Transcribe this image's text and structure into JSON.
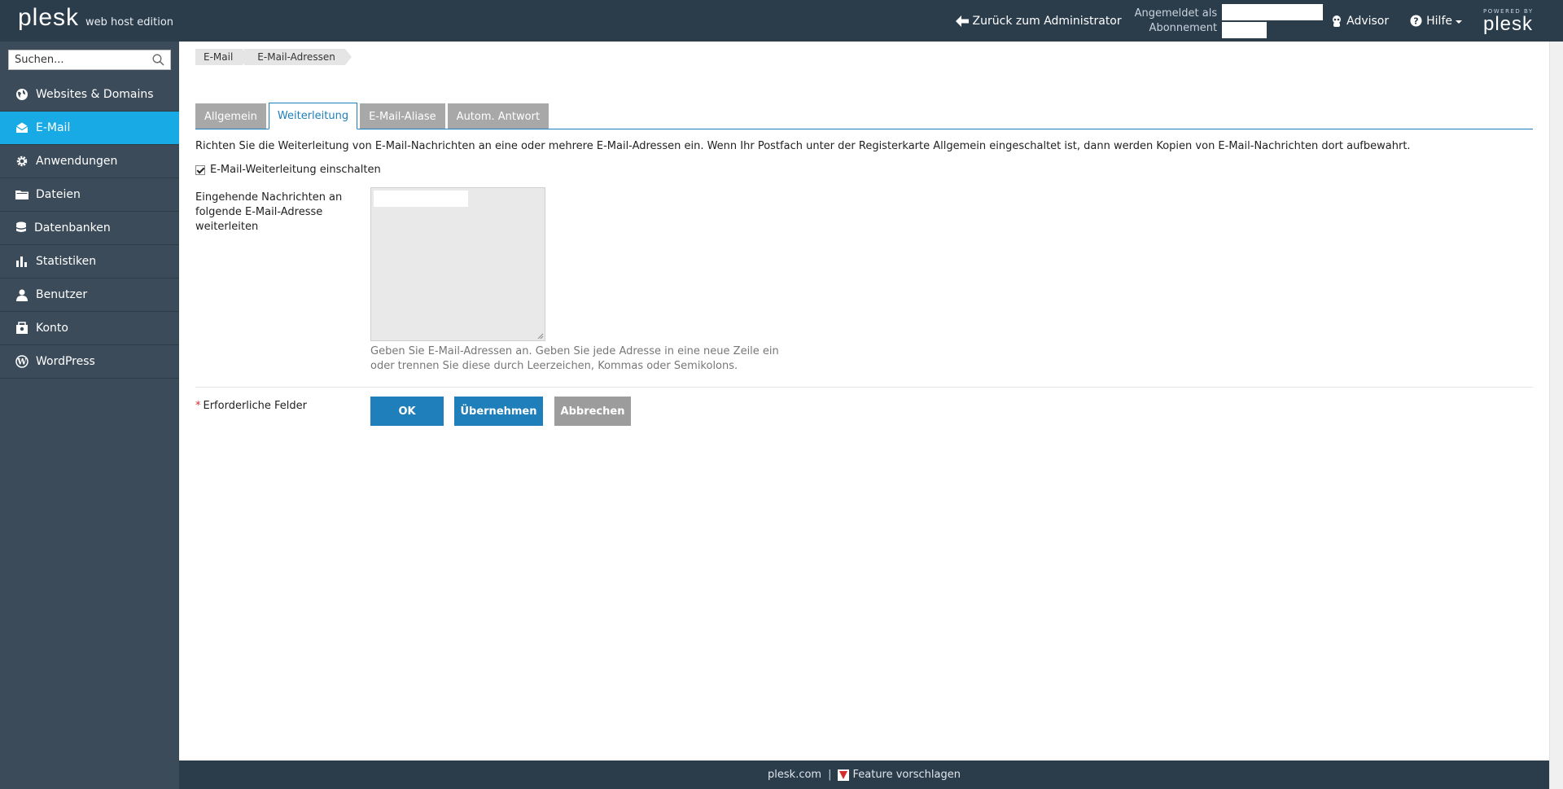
{
  "header": {
    "logo_text": "plesk",
    "edition": "web host edition",
    "back_label": "Zurück zum Administrator",
    "logged_in_label": "Angemeldet als",
    "subscription_label": "Abonnement",
    "advisor_label": "Advisor",
    "help_label": "Hilfe",
    "powered_by": "POWERED BY",
    "powered_logo": "plesk"
  },
  "sidebar": {
    "search_placeholder": "Suchen...",
    "items": [
      {
        "label": "Websites & Domains",
        "icon": "globe-icon"
      },
      {
        "label": "E-Mail",
        "icon": "mail-icon",
        "active": true
      },
      {
        "label": "Anwendungen",
        "icon": "gear-icon"
      },
      {
        "label": "Dateien",
        "icon": "folder-icon"
      },
      {
        "label": "Datenbanken",
        "icon": "database-icon"
      },
      {
        "label": "Statistiken",
        "icon": "bar-chart-icon"
      },
      {
        "label": "Benutzer",
        "icon": "user-icon"
      },
      {
        "label": "Konto",
        "icon": "account-icon"
      },
      {
        "label": "WordPress",
        "icon": "wordpress-icon"
      }
    ]
  },
  "breadcrumb": [
    "E-Mail",
    "E-Mail-Adressen"
  ],
  "tabs": [
    {
      "label": "Allgemein"
    },
    {
      "label": "Weiterleitung",
      "active": true
    },
    {
      "label": "E-Mail-Aliase"
    },
    {
      "label": "Autom. Antwort"
    }
  ],
  "form": {
    "intro": "Richten Sie die Weiterleitung von E-Mail-Nachrichten an eine oder mehrere E-Mail-Adressen ein. Wenn Ihr Postfach unter der Registerkarte Allgemein eingeschaltet ist, dann werden Kopien von E-Mail-Nachrichten dort aufbewahrt.",
    "enable_checkbox_label": "E-Mail-Weiterleitung einschalten",
    "enable_checked": true,
    "forward_label": "Eingehende Nachrichten an folgende E-Mail-Adresse weiterleiten",
    "hint": "Geben Sie E-Mail-Adressen an. Geben Sie jede Adresse in eine neue Zeile ein oder trennen Sie diese durch Leerzeichen, Kommas oder Semikolons.",
    "required_label": "Erforderliche Felder",
    "required_marker": "*",
    "ok_label": "OK",
    "apply_label": "Übernehmen",
    "cancel_label": "Abbrechen"
  },
  "footer": {
    "site_link": "plesk.com",
    "separator": "|",
    "feature_link": "Feature vorschlagen"
  },
  "colors": {
    "header_bg": "#2b3c4b",
    "sidebar_bg": "#3b4b59",
    "active_nav": "#17aae5",
    "primary_button": "#1e7fba",
    "cancel_button": "#9c9c9c",
    "tab_inactive": "#a8a8a8"
  }
}
